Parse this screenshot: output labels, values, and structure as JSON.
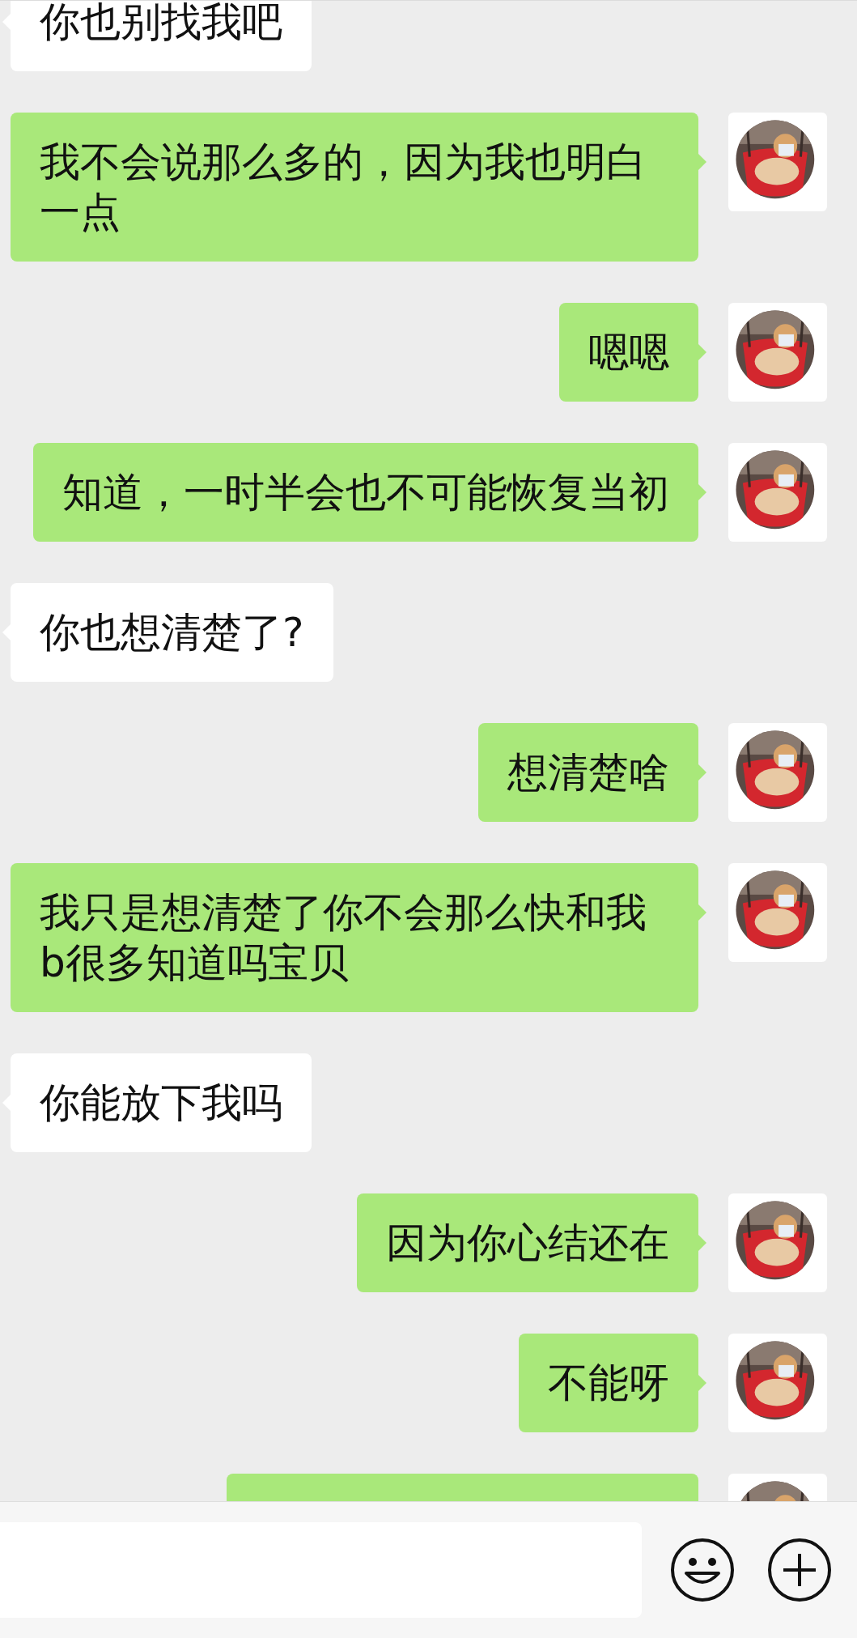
{
  "messages": [
    {
      "kind": "received",
      "text": "你也别找我吧"
    },
    {
      "kind": "sent",
      "text": "我不会说那么多的，因为我也明白一点"
    },
    {
      "kind": "sent",
      "text": "嗯嗯"
    },
    {
      "kind": "sent",
      "text": "知道，一时半会也不可能恢复当初"
    },
    {
      "kind": "received",
      "text": "你也想清楚了?"
    },
    {
      "kind": "sent",
      "text": "想清楚啥"
    },
    {
      "kind": "sent",
      "text": "我只是想清楚了你不会那么快和我b很多知道吗宝贝"
    },
    {
      "kind": "received",
      "text": "你能放下我吗"
    },
    {
      "kind": "sent",
      "text": "因为你心结还在"
    },
    {
      "kind": "sent",
      "text": "不能呀"
    },
    {
      "kind": "sent"
    }
  ]
}
